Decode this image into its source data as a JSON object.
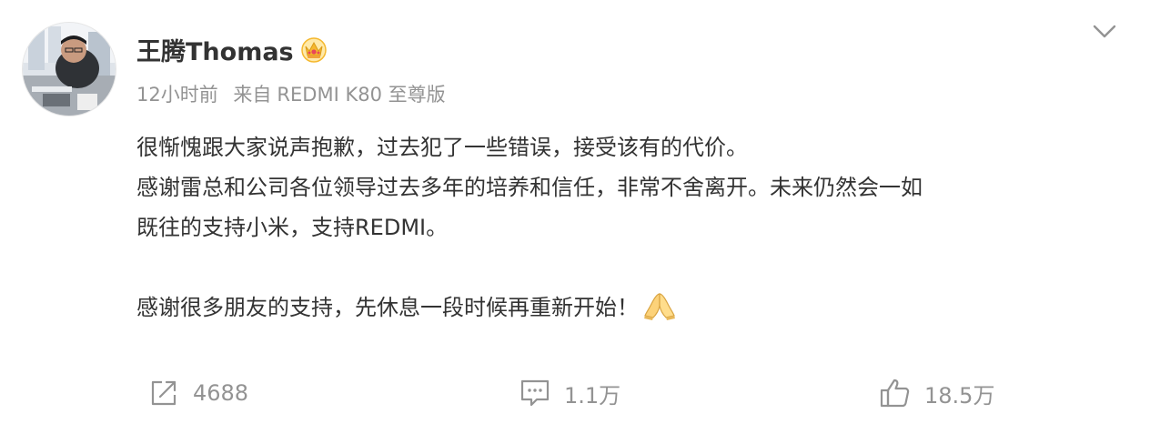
{
  "post": {
    "author": {
      "name": "王腾Thomas",
      "badge_icon": "crown-badge-icon"
    },
    "meta": {
      "time": "12小时前",
      "source_prefix": "来自",
      "source_device": "REDMI K80 至尊版"
    },
    "content": {
      "line_1": "很惭愧跟大家说声抱歉，过去犯了一些错误，接受该有的代价。",
      "line_2": "感谢雷总和公司各位领导过去多年的培养和信任，非常不舍离开。未来仍然会一如",
      "line_3": "既往的支持小米，支持REDMI。",
      "line_4": "感谢很多朋友的支持，先休息一段时候再重新开始！",
      "emoji": "folded-hands-emoji"
    },
    "actions": {
      "repost_count": "4688",
      "comment_count": "1.1万",
      "like_count": "18.5万"
    }
  },
  "icons": {
    "menu": "chevron-down-icon",
    "repost": "share-icon",
    "comment": "comment-icon",
    "like": "thumbs-up-icon"
  },
  "colors": {
    "text_primary": "#333333",
    "text_secondary": "#939393",
    "badge_gold": "#f5b82e",
    "badge_red": "#e8475a"
  }
}
